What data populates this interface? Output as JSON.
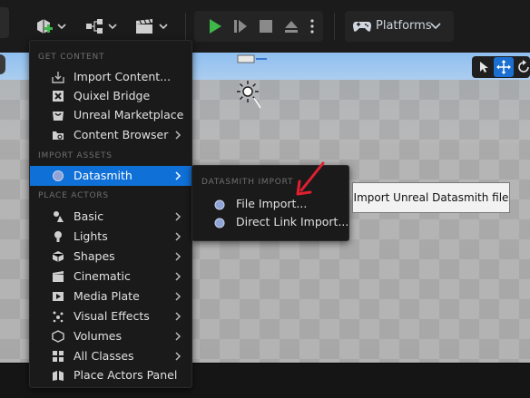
{
  "toolbar": {
    "platforms_label": "Platforms"
  },
  "add_menu": {
    "sections": [
      {
        "header": "GET CONTENT",
        "items": [
          {
            "label": "Import Content...",
            "icon": "import-icon",
            "submenu": false
          },
          {
            "label": "Quixel Bridge",
            "icon": "quixel-icon",
            "submenu": false
          },
          {
            "label": "Unreal Marketplace",
            "icon": "marketplace-icon",
            "submenu": false
          },
          {
            "label": "Content Browser",
            "icon": "content-browser-icon",
            "submenu": true
          }
        ]
      },
      {
        "header": "IMPORT ASSETS",
        "items": [
          {
            "label": "Datasmith",
            "icon": "datasmith-icon",
            "submenu": true,
            "active": true
          }
        ]
      },
      {
        "header": "PLACE ACTORS",
        "items": [
          {
            "label": "Basic",
            "icon": "basic-shapes-icon",
            "submenu": true
          },
          {
            "label": "Lights",
            "icon": "light-bulb-icon",
            "submenu": true
          },
          {
            "label": "Shapes",
            "icon": "cube-icon",
            "submenu": true
          },
          {
            "label": "Cinematic",
            "icon": "film-icon",
            "submenu": true
          },
          {
            "label": "Media Plate",
            "icon": "media-plate-icon",
            "submenu": true
          },
          {
            "label": "Visual Effects",
            "icon": "sparkles-icon",
            "submenu": true
          },
          {
            "label": "Volumes",
            "icon": "volume-icon",
            "submenu": true
          },
          {
            "label": "All Classes",
            "icon": "all-classes-icon",
            "submenu": true
          },
          {
            "label": "Place Actors Panel",
            "icon": "place-actors-icon",
            "submenu": false
          }
        ]
      }
    ]
  },
  "datasmith_submenu": {
    "header": "DATASMITH IMPORT",
    "items": [
      {
        "label": "File Import...",
        "icon": "datasmith-icon"
      },
      {
        "label": "Direct Link Import...",
        "icon": "datasmith-icon"
      }
    ]
  },
  "tooltip": {
    "text": "Import Unreal Datasmith file"
  },
  "colors": {
    "accent": "#0f70d7",
    "play_green": "#3fb84a",
    "annotation_red": "#e02030"
  }
}
